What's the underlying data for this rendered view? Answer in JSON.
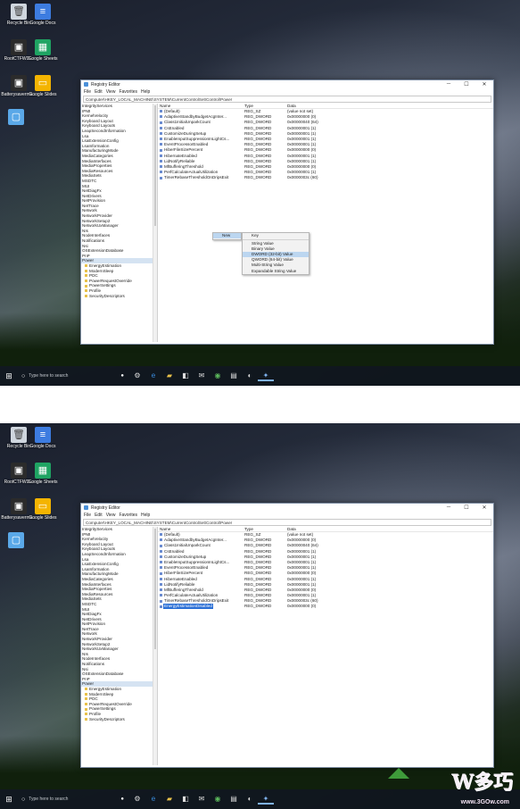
{
  "desktop_icons": [
    {
      "label": "Recycle Bin",
      "icon": "recycle-bin-icon"
    },
    {
      "label": "Google Docs",
      "icon": "google-docs-icon"
    },
    {
      "label": "RootCTFWD...",
      "icon": "shortcut-icon"
    },
    {
      "label": "Google Sheets",
      "icon": "google-sheets-icon"
    },
    {
      "label": "Batterysaverma...",
      "icon": "shortcut-icon"
    },
    {
      "label": "Google Slides",
      "icon": "google-slides-icon"
    },
    {
      "label": "",
      "icon": "monitor-icon"
    }
  ],
  "regedit": {
    "title": "Registry Editor",
    "menu": [
      "File",
      "Edit",
      "View",
      "Favorites",
      "Help"
    ],
    "address": "Computer\\HKEY_LOCAL_MACHINE\\SYSTEM\\CurrentControlSet\\Control\\Power",
    "tree_nodes": [
      "IntegrityServices",
      "IPMI",
      "KernelVelocity",
      "Keyboard Layout",
      "Keyboard Layouts",
      "LeapSecondInformation",
      "Lsa",
      "LsaExtensionConfig",
      "LsaInformation",
      "ManufacturingMode",
      "MediaCategories",
      "MediaInterfaces",
      "MediaProperties",
      "MediaResources",
      "MediaSets",
      "MSDTC",
      "MUI",
      "NetDiagFx",
      "NetDrivers",
      "NetProvision",
      "NetTrace",
      "Network",
      "NetworkProvider",
      "NetworkSetup2",
      "NetworkUxManager",
      "NIs",
      "NodeInterfaces",
      "Notifications",
      "Nsi",
      "OSExtensionDatabase",
      "PnP"
    ],
    "selected_node": "Power",
    "power_children": [
      "EnergyEstimation",
      "ModernSleep",
      "PDC",
      "PowerRequestOverride",
      "PowerSettings",
      "Profile",
      "SecurityDescriptors"
    ],
    "columns": {
      "name": "Name",
      "type": "Type",
      "data": "Data"
    },
    "values": [
      {
        "name": "(Default)",
        "type": "REG_SZ",
        "data": "(value not set)"
      },
      {
        "name": "AdaptiveStandbyBudgetAcgInter...",
        "type": "REG_DWORD",
        "data": "0x00000000 (0)"
      },
      {
        "name": "Class1InitialUnparkCount",
        "type": "REG_DWORD",
        "data": "0x00000040 (64)"
      },
      {
        "name": "CsEnabled",
        "type": "REG_DWORD",
        "data": "0x00000001 (1)"
      },
      {
        "name": "CustomizeDuringSetup",
        "type": "REG_DWORD",
        "data": "0x00000001 (1)"
      },
      {
        "name": "EnableInputSuppressionInLightCs...",
        "type": "REG_DWORD",
        "data": "0x00000001 (1)"
      },
      {
        "name": "EventProcessorEnabled",
        "type": "REG_DWORD",
        "data": "0x00000001 (1)"
      },
      {
        "name": "HiberFileSizePercent",
        "type": "REG_DWORD",
        "data": "0x00000000 (0)"
      },
      {
        "name": "HibernateEnabled",
        "type": "REG_DWORD",
        "data": "0x00000001 (1)"
      },
      {
        "name": "LidNotifyReliable",
        "type": "REG_DWORD",
        "data": "0x00000001 (1)"
      },
      {
        "name": "MfBufferingThreshold",
        "type": "REG_DWORD",
        "data": "0x00000000 (0)"
      },
      {
        "name": "PerfCalculateActualUtilization",
        "type": "REG_DWORD",
        "data": "0x00000001 (1)"
      },
      {
        "name": "TimerRebaseThresholdOnDripsExit",
        "type": "REG_DWORD",
        "data": "0x0000003c (60)"
      }
    ],
    "new_value": {
      "name": "EnergyEstimationDisabled",
      "type": "REG_DWORD",
      "data": "0x00000000 (0)"
    }
  },
  "context_menu": {
    "new_label": "New",
    "items": [
      "Key",
      "String Value",
      "Binary Value",
      "DWORD (32-bit) Value",
      "QWORD (64-bit) Value",
      "Multi-String Value",
      "Expandable String Value"
    ],
    "highlighted": "DWORD (32-bit) Value"
  },
  "taskbar": {
    "search_placeholder": "Type here to search",
    "icons": [
      "cortana-mic-icon",
      "settings-icon",
      "edge-icon",
      "folder-icon",
      "store-icon",
      "mail-icon",
      "app-icon",
      "photos-icon",
      "steam-icon",
      "regedit-icon"
    ]
  },
  "watermark": {
    "text": "W多巧",
    "url": "www.3GOw.com"
  }
}
